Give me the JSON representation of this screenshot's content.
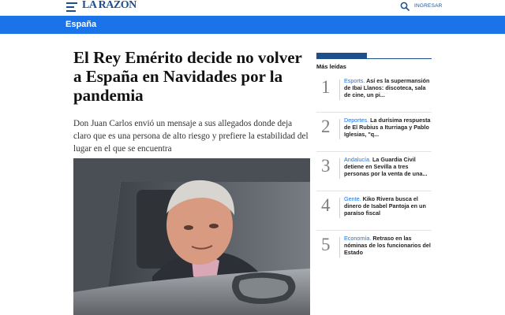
{
  "header": {
    "logo": "LA RAZÓN",
    "login_label": "INGRESAR"
  },
  "section": {
    "label": "España"
  },
  "article": {
    "headline": "El Rey Emérito decide no volver a España en Navidades por la pandemia",
    "lead": "Don Juan Carlos envió un mensaje a sus allegados donde deja claro que es una persona de alto riesgo y prefiere la estabilidad del lugar en el que se encuentra"
  },
  "sidebar": {
    "title": "Más leídas",
    "items": [
      {
        "number": "1",
        "category": "Esports.",
        "text": "Así es la supermansión de Ibai Llanos: discoteca, sala de cine, un pi..."
      },
      {
        "number": "2",
        "category": "Deportes.",
        "text": "La durísima respuesta de El Rubius a Iturriaga y Pablo Iglesias, \"q..."
      },
      {
        "number": "3",
        "category": "Andalucía.",
        "text": "La Guardia Civil detiene en Sevilla a tres personas por la venta de una..."
      },
      {
        "number": "4",
        "category": "Gente.",
        "text": "Kiko Rivera busca el dinero de Isabel Pantoja en un paraíso fiscal"
      },
      {
        "number": "5",
        "category": "Economía.",
        "text": "Retraso en las nóminas de los funcionarios del Estado"
      }
    ]
  },
  "colors": {
    "brand": "#1d4f8c",
    "section_bar": "#1a73e8",
    "category": "#1a73e8"
  }
}
